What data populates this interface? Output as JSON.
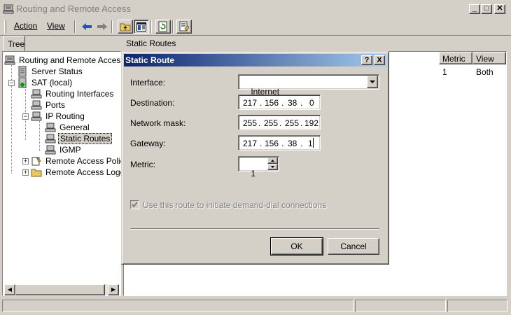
{
  "window": {
    "title": "Routing and Remote Access"
  },
  "menu": {
    "action": "Action",
    "view": "View"
  },
  "tree": {
    "tab_label": "Tree",
    "items": [
      {
        "label": "Routing and Remote Access"
      },
      {
        "label": "Server Status"
      },
      {
        "label": "SAT (local)"
      },
      {
        "label": "Routing Interfaces"
      },
      {
        "label": "Ports"
      },
      {
        "label": "IP Routing"
      },
      {
        "label": "General"
      },
      {
        "label": "Static Routes"
      },
      {
        "label": "IGMP"
      },
      {
        "label": "Remote Access Policie"
      },
      {
        "label": "Remote Access Loggir"
      }
    ]
  },
  "right_pane": {
    "header": "Static Routes",
    "columns": {
      "metric": "Metric",
      "view": "View"
    },
    "row": {
      "metric": "1",
      "view": "Both"
    }
  },
  "dialog": {
    "title": "Static Route",
    "help_btn": "?",
    "close_btn": "X",
    "interface_label": "Interface:",
    "interface_value": "Internet",
    "destination_label": "Destination:",
    "destination": [
      "217",
      "156",
      "38",
      "0"
    ],
    "mask_label": "Network mask:",
    "mask": [
      "255",
      "255",
      "255",
      "192"
    ],
    "gateway_label": "Gateway:",
    "gateway": [
      "217",
      "156",
      "38",
      "1"
    ],
    "metric_label": "Metric:",
    "metric_value": "1",
    "demand_dial_label": "Use this route to initiate demand-dial connections",
    "ok": "OK",
    "cancel": "Cancel"
  },
  "colors": {
    "titlebar_active": "#0a246a",
    "titlebar_gradient_end": "#a6caf0",
    "face": "#d4d0c8"
  }
}
